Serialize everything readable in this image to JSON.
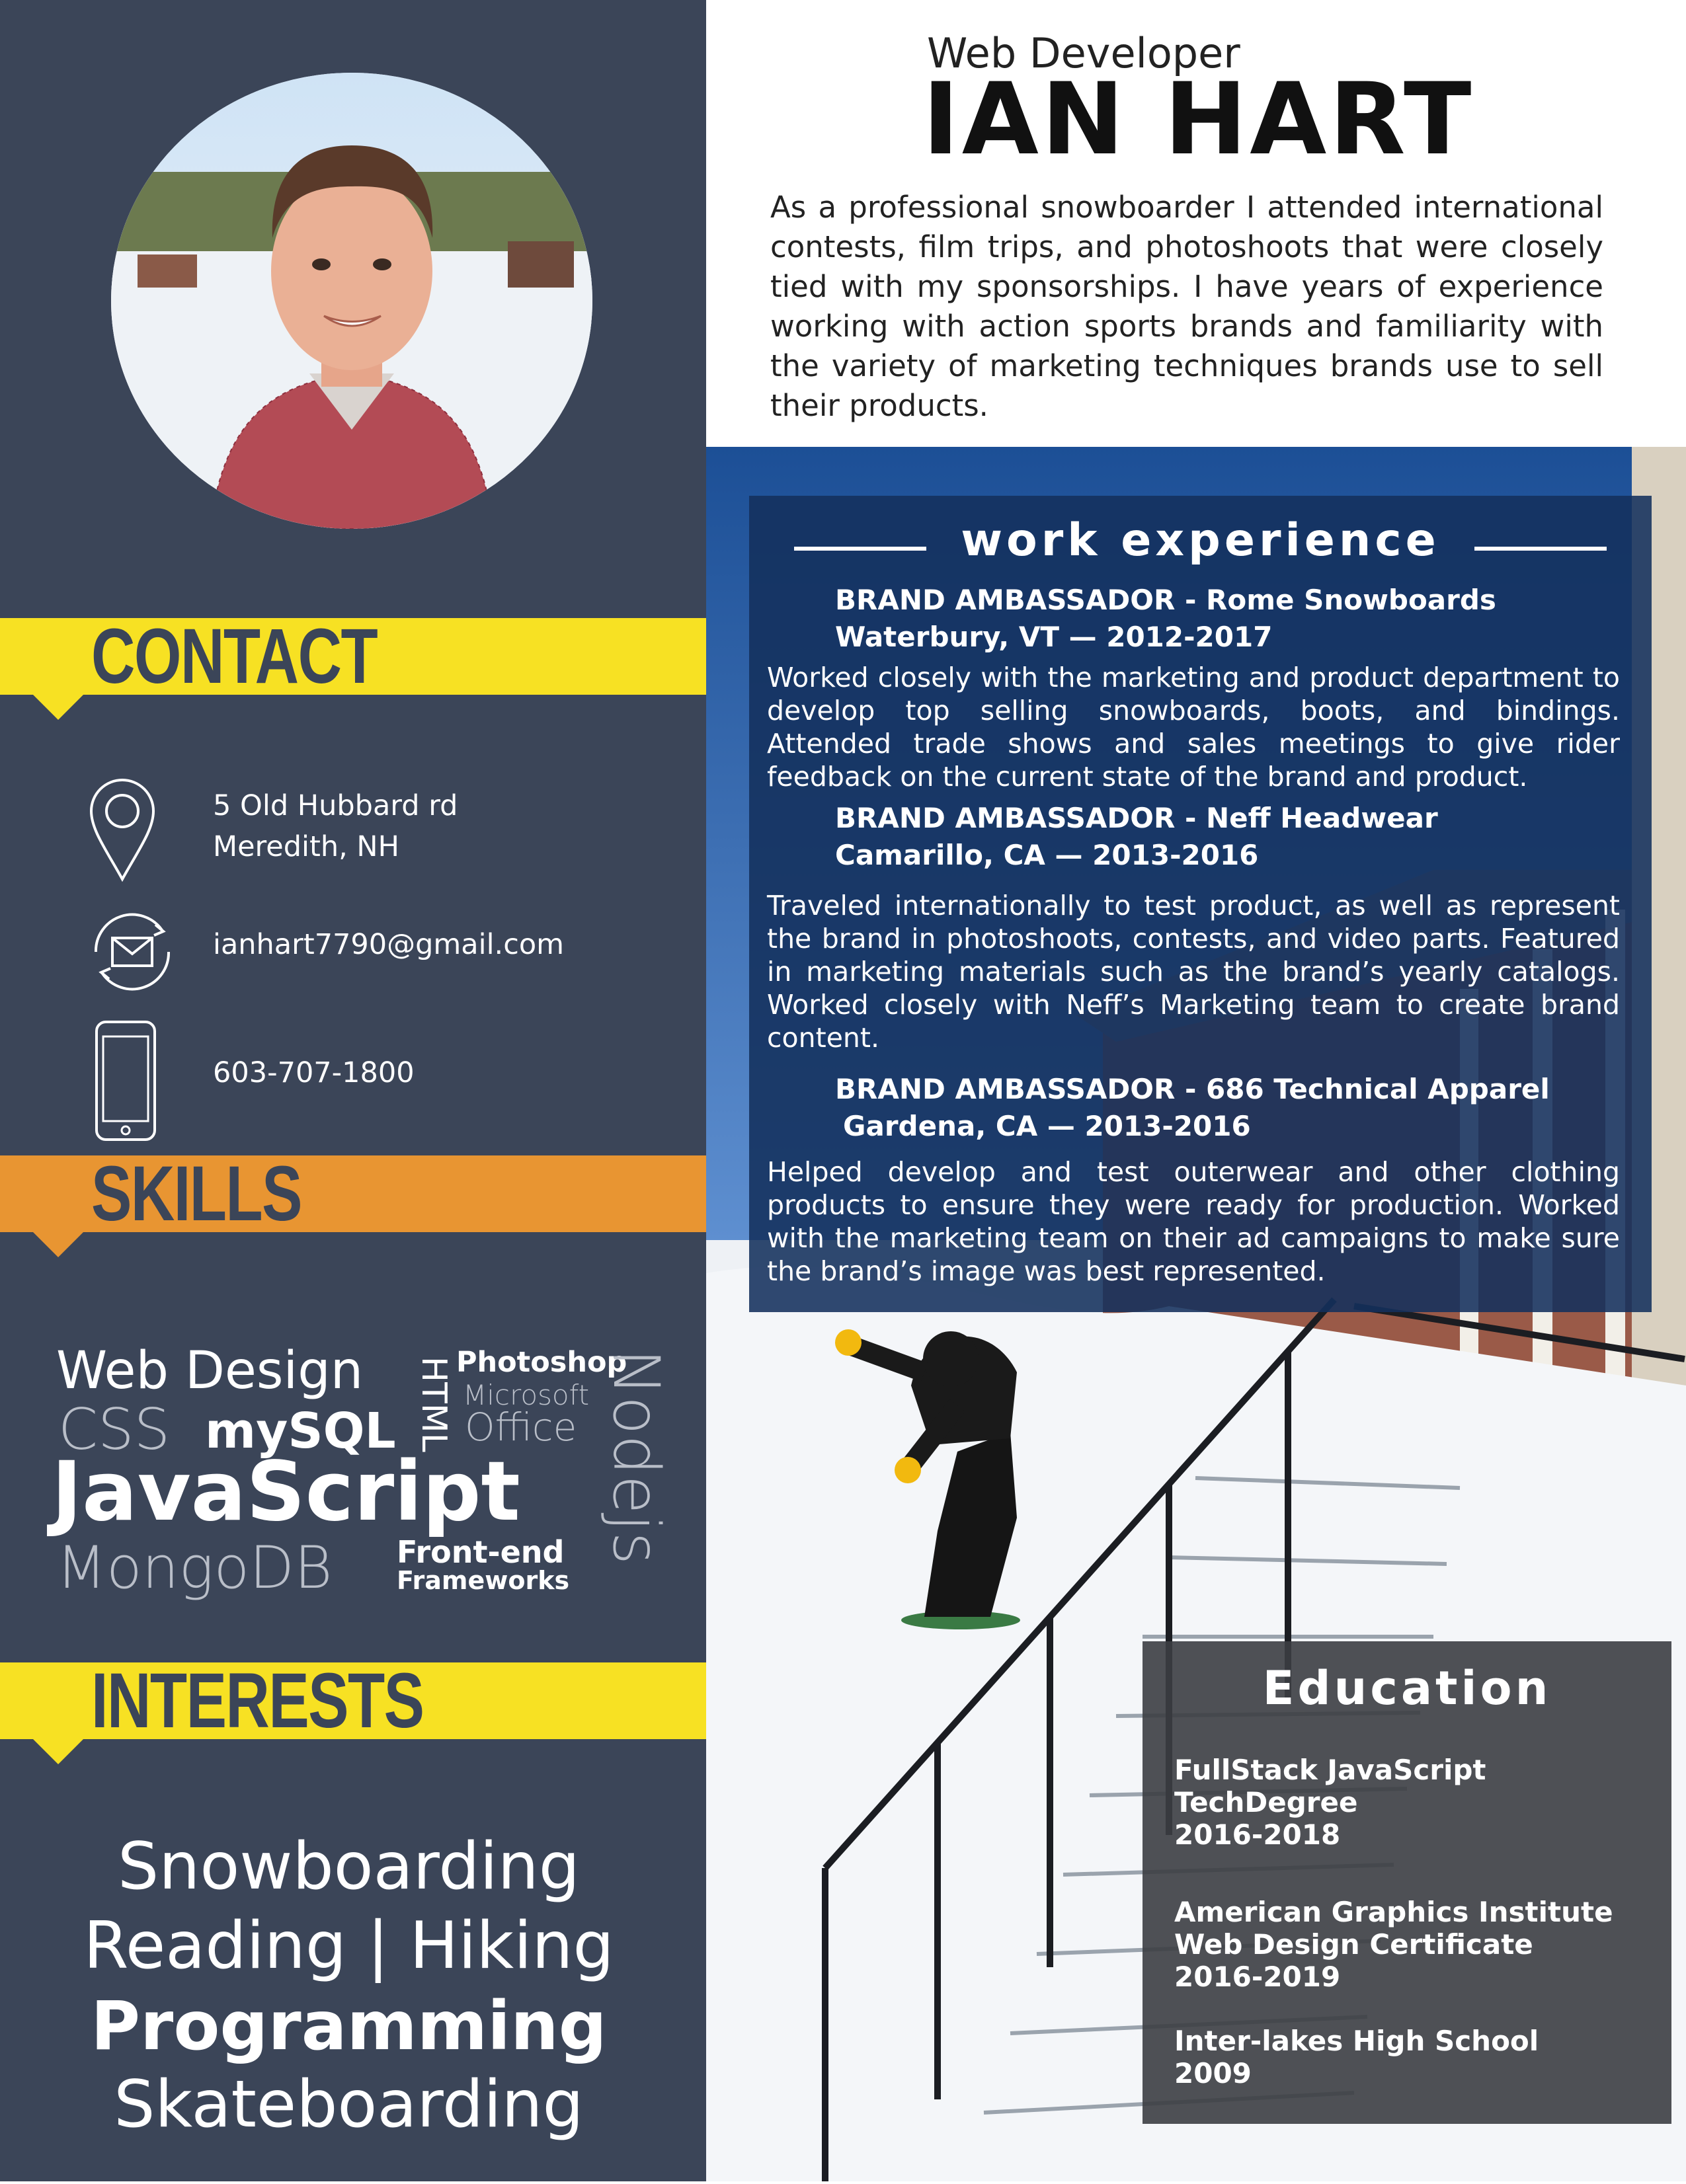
{
  "header": {
    "job_title": "Web Developer",
    "name": "IAN HART",
    "summary": "As a professional snowboarder I attended international contests, film trips, and photoshoots that were closely tied with my sponsorships. I have years of experience working with action sports brands and familiarity with the variety of marketing techniques brands use to sell their products."
  },
  "sections": {
    "contact": "CONTACT",
    "skills": "SKILLS",
    "interests": "INTERESTS",
    "work": "work experience",
    "education": "Education"
  },
  "contact": {
    "address_line1": "5 Old Hubbard rd",
    "address_line2": "Meredith, NH",
    "email": "ianhart7790@gmail.com",
    "phone": "603-707-1800"
  },
  "skills": {
    "web_design": "Web Design",
    "html": "HTML",
    "photoshop": "Photoshop",
    "microsoft": "Microsoft",
    "office": "Office",
    "css": "CSS",
    "mysql": "mySQL",
    "javascript": "JavaScript",
    "mongodb": "MongoDB",
    "frontend_line1": "Front-end",
    "frontend_line2": "Frameworks",
    "nodejs": "Nodejs"
  },
  "interests": {
    "line1": "Snowboarding",
    "line2": "Reading | Hiking",
    "line3": "Programming",
    "line4": "Skateboarding"
  },
  "work": [
    {
      "title": "BRAND AMBASSADOR - Rome Snowboards",
      "location": "Waterbury, VT — 2012-2017",
      "description": "Worked closely with the marketing and product department to develop top selling snowboards, boots, and bindings. Attended trade shows and sales meetings to give rider feedback on the current state of the brand and product."
    },
    {
      "title": "BRAND AMBASSADOR - Neff Headwear",
      "location": "Camarillo, CA — 2013-2016",
      "description": "Traveled internationally to test product, as well as represent the brand in photoshoots, contests, and video parts. Featured in marketing materials such as the brand’s yearly catalogs. Worked closely with Neff’s Marketing team to create brand content."
    },
    {
      "title": "BRAND AMBASSADOR - 686 Technical Apparel",
      "location": "Gardena, CA — 2013-2016",
      "description": "Helped develop and test outerwear and other clothing products to ensure they were ready for production. Worked with the marketing team on their ad campaigns to make sure the brand’s image was best represented."
    }
  ],
  "education": [
    {
      "line1": "FullStack JavaScript",
      "line2": "TechDegree",
      "line3": "2016-2018"
    },
    {
      "line1": "American Graphics Institute",
      "line2": "Web Design Certificate",
      "line3": "2016-2019"
    },
    {
      "line1": "Inter-lakes High School",
      "line2": "2009"
    }
  ],
  "colors": {
    "sidebar": "#3b4558",
    "yellow_banner": "#f7e123",
    "orange_banner": "#e89532",
    "work_box": "#13305c",
    "edu_box": "#3c3e42"
  },
  "icons": {
    "address": "map-pin-icon",
    "email": "envelope-icon",
    "phone": "smartphone-icon"
  }
}
